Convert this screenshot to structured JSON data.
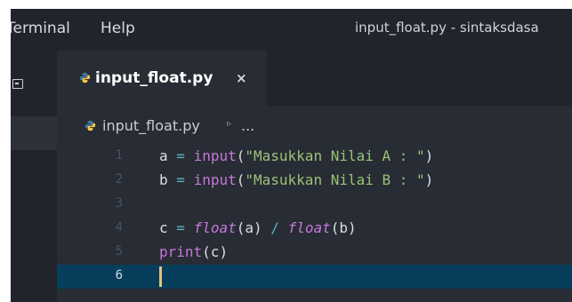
{
  "menu": {
    "terminal": "Terminal",
    "help": "Help"
  },
  "window_title": "input_float.py - sintaksdasa",
  "tab": {
    "label": "input_float.py",
    "close": "×"
  },
  "breadcrumb": {
    "file": "input_float.py",
    "arrow": "▹",
    "more": "..."
  },
  "editor": {
    "current_line": 6,
    "lines": [
      {
        "n": "1",
        "tokens": [
          [
            "var",
            "a"
          ],
          [
            "punc",
            " "
          ],
          [
            "op",
            "="
          ],
          [
            "punc",
            " "
          ],
          [
            "fn",
            "input"
          ],
          [
            "punc",
            "("
          ],
          [
            "str",
            "\"Masukkan Nilai A : \""
          ],
          [
            "punc",
            ")"
          ]
        ]
      },
      {
        "n": "2",
        "tokens": [
          [
            "var",
            "b"
          ],
          [
            "punc",
            " "
          ],
          [
            "op",
            "="
          ],
          [
            "punc",
            " "
          ],
          [
            "fn",
            "input"
          ],
          [
            "punc",
            "("
          ],
          [
            "str",
            "\"Masukkan Nilai B : \""
          ],
          [
            "punc",
            ")"
          ]
        ]
      },
      {
        "n": "3",
        "tokens": []
      },
      {
        "n": "4",
        "tokens": [
          [
            "var",
            "c"
          ],
          [
            "punc",
            " "
          ],
          [
            "op",
            "="
          ],
          [
            "punc",
            " "
          ],
          [
            "fn-i",
            "float"
          ],
          [
            "punc",
            "(a)"
          ],
          [
            "punc",
            " "
          ],
          [
            "op",
            "/"
          ],
          [
            "punc",
            " "
          ],
          [
            "fn-i",
            "float"
          ],
          [
            "punc",
            "(b)"
          ]
        ]
      },
      {
        "n": "5",
        "tokens": [
          [
            "fn",
            "print"
          ],
          [
            "punc",
            "(c)"
          ]
        ]
      },
      {
        "n": "6",
        "tokens": []
      }
    ]
  },
  "colors": {
    "editor_bg": "#282c34",
    "current_line_bg": "#063e5c",
    "string": "#98c379",
    "keyword_fn": "#c678dd",
    "operator": "#56b6c2",
    "python_icon": "#3c78aa"
  },
  "icons": {
    "file_icon": "python-icon",
    "panel_icon": "terminal-panel-icon",
    "close_icon": "close-icon"
  }
}
